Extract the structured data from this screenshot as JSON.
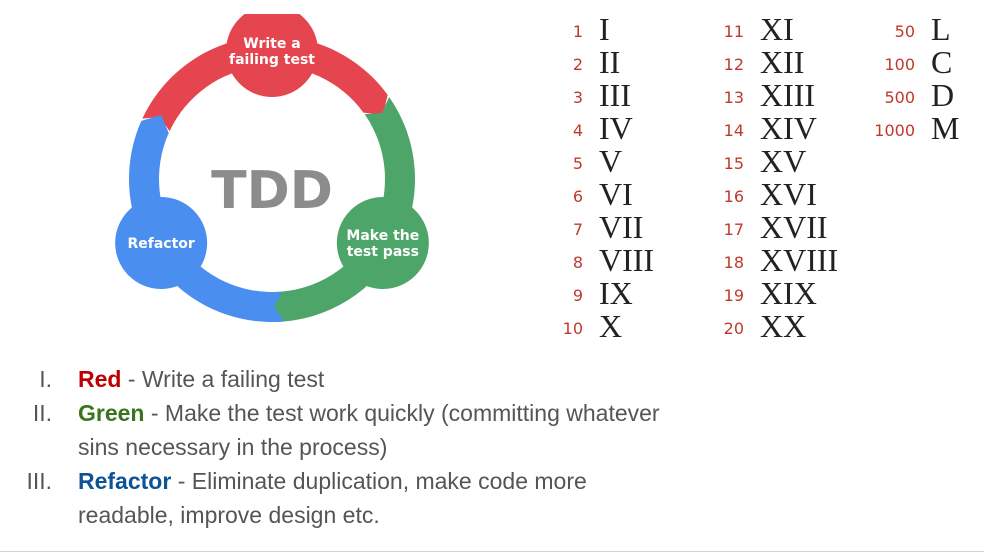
{
  "cycle": {
    "center_label": "TDD",
    "nodes": [
      {
        "lines": [
          "Write a",
          "failing test"
        ],
        "color": "#e5454f"
      },
      {
        "lines": [
          "Make the",
          "test pass"
        ],
        "color": "#4ea56a"
      },
      {
        "lines": [
          "Refactor"
        ],
        "color": "#4a8ff0"
      }
    ],
    "center_color": "#8c8c8c"
  },
  "roman_numerals": {
    "columns": [
      [
        {
          "n": "1",
          "r": "I"
        },
        {
          "n": "2",
          "r": "II"
        },
        {
          "n": "3",
          "r": "III"
        },
        {
          "n": "4",
          "r": "IV"
        },
        {
          "n": "5",
          "r": "V"
        },
        {
          "n": "6",
          "r": "VI"
        },
        {
          "n": "7",
          "r": "VII"
        },
        {
          "n": "8",
          "r": "VIII"
        },
        {
          "n": "9",
          "r": "IX"
        },
        {
          "n": "10",
          "r": "X"
        }
      ],
      [
        {
          "n": "11",
          "r": "XI"
        },
        {
          "n": "12",
          "r": "XII"
        },
        {
          "n": "13",
          "r": "XIII"
        },
        {
          "n": "14",
          "r": "XIV"
        },
        {
          "n": "15",
          "r": "XV"
        },
        {
          "n": "16",
          "r": "XVI"
        },
        {
          "n": "17",
          "r": "XVII"
        },
        {
          "n": "18",
          "r": "XVIII"
        },
        {
          "n": "19",
          "r": "XIX"
        },
        {
          "n": "20",
          "r": "XX"
        }
      ],
      [
        {
          "n": "50",
          "r": "L"
        },
        {
          "n": "100",
          "r": "C"
        },
        {
          "n": "500",
          "r": "D"
        },
        {
          "n": "1000",
          "r": "M"
        }
      ]
    ],
    "number_color": "#c0392b"
  },
  "steps": [
    {
      "marker": "I.",
      "name": "Red",
      "name_color": "#c00000",
      "text": " - Write a failing test"
    },
    {
      "marker": "II.",
      "name": "Green",
      "name_color": "#38761d",
      "text": " - Make the test work quickly (committing whatever sins necessary in the process)"
    },
    {
      "marker": "III.",
      "name": "Refactor",
      "name_color": "#0b5394",
      "text": " - Eliminate duplication, make code more readable, improve design etc."
    }
  ]
}
